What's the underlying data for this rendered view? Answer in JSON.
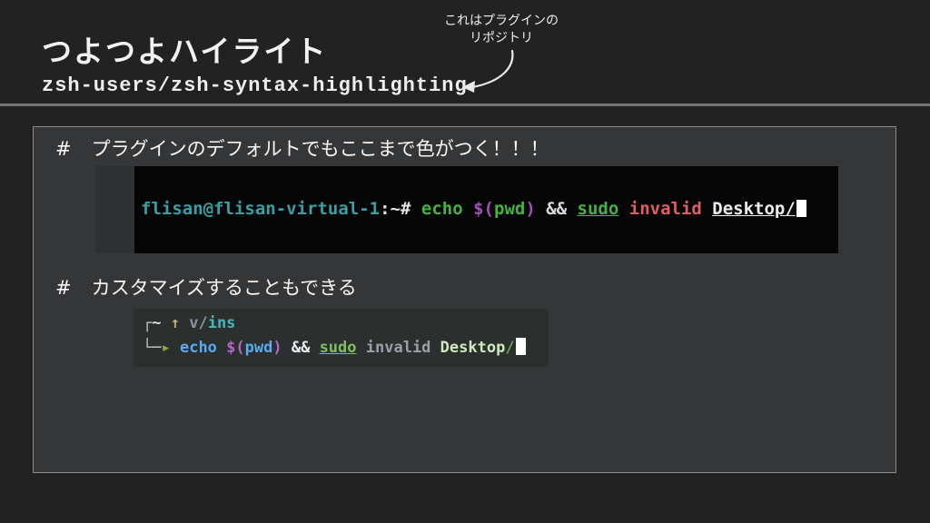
{
  "header": {
    "title": "つよつよハイライト",
    "subtitle": "zsh-users/zsh-syntax-highlighting",
    "annotation": {
      "line1": "これはプラグインの",
      "line2": "リポジトリ"
    }
  },
  "sections": [
    {
      "hash": "#",
      "text": "プラグインのデフォルトでもここまで色がつく！！！"
    },
    {
      "hash": "#",
      "text": "カスタマイズすることもできる"
    }
  ],
  "colors": {
    "page_bg": "#222222",
    "panel_bg": "#353638",
    "panel_border": "#8a8d90",
    "divider": "#737373",
    "terminal1_bg": "#050505",
    "terminal1_strip": "#2e3033",
    "terminal2_bg": "#2b2f2e",
    "annotation_arrow": "#e9e9e9",
    "cursor": "#ffffff"
  },
  "terminal1": {
    "line": [
      {
        "t": "flisan@flisan-virtual-1",
        "c": "#36a0a6"
      },
      {
        "t": ":",
        "c": "#e6e6e6"
      },
      {
        "t": "~",
        "c": "#e6e6e6"
      },
      {
        "t": "# ",
        "c": "#e6e6e6"
      },
      {
        "t": "echo ",
        "c": "#44b340"
      },
      {
        "t": "$(",
        "c": "#a44ebc"
      },
      {
        "t": "pwd",
        "c": "#44b340"
      },
      {
        "t": ") ",
        "c": "#a44ebc"
      },
      {
        "t": "&& ",
        "c": "#dcdcdc"
      },
      {
        "t": "sudo",
        "c": "#44b340",
        "u": true
      },
      {
        "t": " ",
        "c": "#dcdcdc"
      },
      {
        "t": "invalid",
        "c": "#e05f5f"
      },
      {
        "t": " ",
        "c": "#dcdcdc"
      },
      {
        "t": "Desktop/",
        "c": "#ececec",
        "u": true
      },
      {
        "cursor": true
      }
    ]
  },
  "terminal2": {
    "line1": [
      {
        "t": "┌",
        "c": "#c2c6cc"
      },
      {
        "t": "~ ",
        "c": "#dde1e6"
      },
      {
        "t": "↑ ",
        "c": "#c9ab76"
      },
      {
        "t": "v/",
        "c": "#8d949c"
      },
      {
        "t": "ins",
        "c": "#45b8b8"
      }
    ],
    "line2": [
      {
        "t": "└─",
        "c": "#c2c6cc"
      },
      {
        "t": "▸ ",
        "c": "#9aa83f"
      },
      {
        "t": "echo ",
        "c": "#58aaf2"
      },
      {
        "t": "$(",
        "c": "#b864cc"
      },
      {
        "t": "pwd",
        "c": "#58aaf2"
      },
      {
        "t": ") ",
        "c": "#b864cc"
      },
      {
        "t": "&& ",
        "c": "#eef2f6"
      },
      {
        "t": "sudo",
        "c": "#7fbf5d",
        "u": true
      },
      {
        "t": " ",
        "c": "#9aa0a8"
      },
      {
        "t": "invalid",
        "c": "#9aa0a8"
      },
      {
        "t": " ",
        "c": "#9aa0a8"
      },
      {
        "t": "Desktop",
        "c": "#cfe8bc"
      },
      {
        "t": "/",
        "c": "#6da453"
      },
      {
        "cursor": true
      }
    ]
  }
}
